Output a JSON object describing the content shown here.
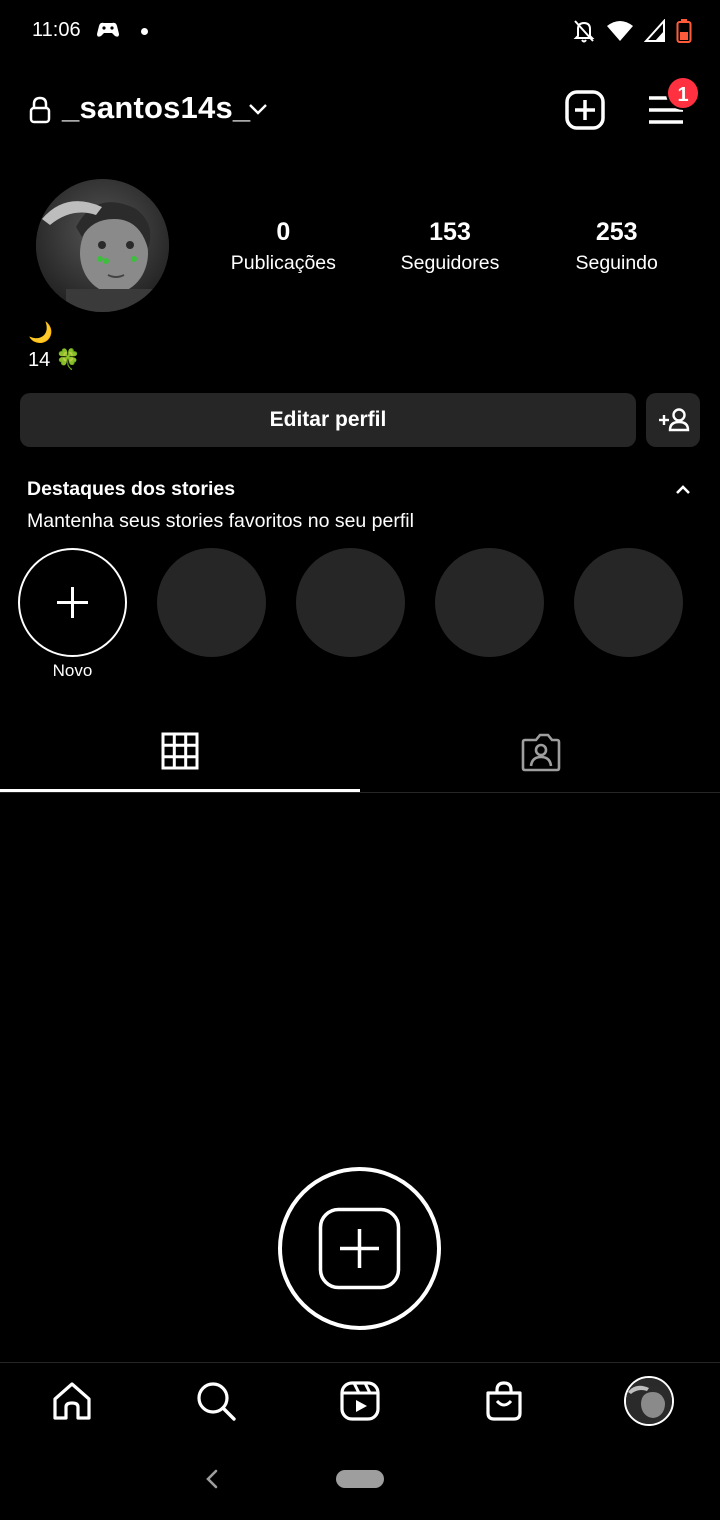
{
  "status_bar": {
    "time": "11:06"
  },
  "header": {
    "username": "_santos14s_",
    "notification_count": "1"
  },
  "stats": [
    {
      "value": "0",
      "label": "Publicações"
    },
    {
      "value": "153",
      "label": "Seguidores"
    },
    {
      "value": "253",
      "label": "Seguindo"
    }
  ],
  "bio": {
    "line1": "🌙",
    "line2": "14 🍀"
  },
  "buttons": {
    "edit_profile": "Editar perfil"
  },
  "highlights": {
    "title": "Destaques dos stories",
    "subtitle": "Mantenha seus stories favoritos no seu perfil",
    "new_label": "Novo"
  },
  "colors": {
    "background": "#000000",
    "surface": "#262626",
    "badge": "#ff3040",
    "text": "#ffffff"
  },
  "icons": {
    "header": [
      "lock-icon",
      "chevron-down-icon",
      "create-post-icon",
      "menu-icon"
    ],
    "tabs": [
      "grid-icon",
      "tagged-person-icon"
    ],
    "bottom_nav": [
      "home-icon",
      "search-icon",
      "reels-icon",
      "shop-icon",
      "profile-avatar"
    ]
  }
}
